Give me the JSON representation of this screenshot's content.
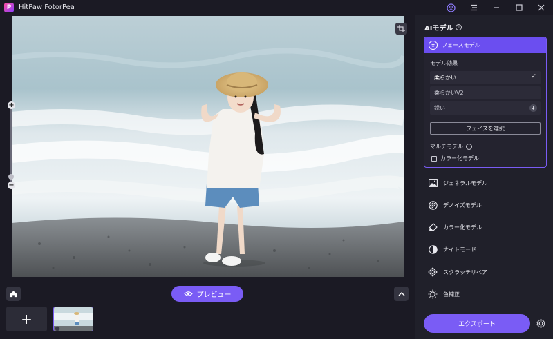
{
  "app": {
    "title": "HitPaw FotorPea",
    "logo_letter": "P",
    "accent_color": "#7a5cf5"
  },
  "titlebar": {
    "icons": [
      "user-icon",
      "menu-icon",
      "minimize-icon",
      "maximize-icon",
      "close-icon"
    ]
  },
  "canvas": {
    "zoom_in_label": "+",
    "zoom_out_label": "−"
  },
  "bottom": {
    "preview_label": "プレビュー",
    "add_label": "+"
  },
  "panel": {
    "title": "AIモデル",
    "face_model": {
      "label": "フェースモデル",
      "effect_title": "モデル効果",
      "options": [
        {
          "label": "柔らかい",
          "selected": true
        },
        {
          "label": "柔らかいV2",
          "selected": false
        },
        {
          "label": "鋭い",
          "selected": false
        }
      ],
      "select_face_label": "フェイスを選択",
      "multi_model_title": "マルチモデル",
      "colorize_checkbox_label": "カラー化モデル"
    },
    "models": [
      {
        "label": "ジェネラルモデル",
        "icon": "image-icon"
      },
      {
        "label": "デノイズモデル",
        "icon": "denoise-icon"
      },
      {
        "label": "カラー化モデル",
        "icon": "color-brush-icon"
      },
      {
        "label": "ナイトモード",
        "icon": "night-mode-icon"
      },
      {
        "label": "スクラッチリペア",
        "icon": "scratch-repair-icon"
      },
      {
        "label": "色補正",
        "icon": "color-correct-icon"
      }
    ],
    "export_label": "エクスポート"
  }
}
